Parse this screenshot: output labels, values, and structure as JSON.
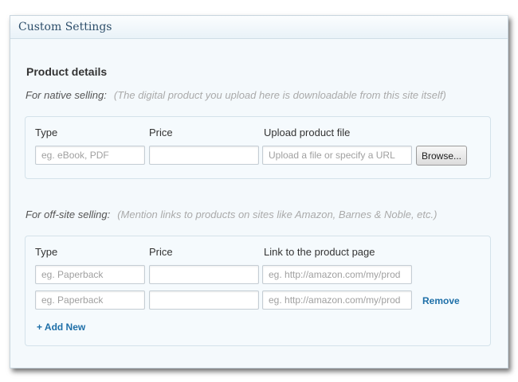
{
  "panel": {
    "title": "Custom Settings"
  },
  "product_details": {
    "title": "Product details"
  },
  "native": {
    "label": "For native selling:",
    "hint": "(The digital product you upload here is downloadable from this site itself)",
    "headers": {
      "type": "Type",
      "price": "Price",
      "file": "Upload product file"
    },
    "type_placeholder": "eg. eBook, PDF",
    "price_value": "",
    "file_placeholder": "Upload a file or specify a URL",
    "browse_label": "Browse..."
  },
  "offsite": {
    "label": "For off-site selling:",
    "hint": "(Mention links to products on sites like Amazon, Barnes & Noble, etc.)",
    "headers": {
      "type": "Type",
      "price": "Price",
      "link": "Link to the product page"
    },
    "rows": [
      {
        "type_placeholder": "eg. Paperback",
        "price_value": "",
        "link_placeholder": "eg. http://amazon.com/my/prod"
      },
      {
        "type_placeholder": "eg. Paperback",
        "price_value": "",
        "link_placeholder": "eg. http://amazon.com/my/prod",
        "remove_label": "Remove"
      }
    ],
    "add_new_label": "+ Add New"
  }
}
